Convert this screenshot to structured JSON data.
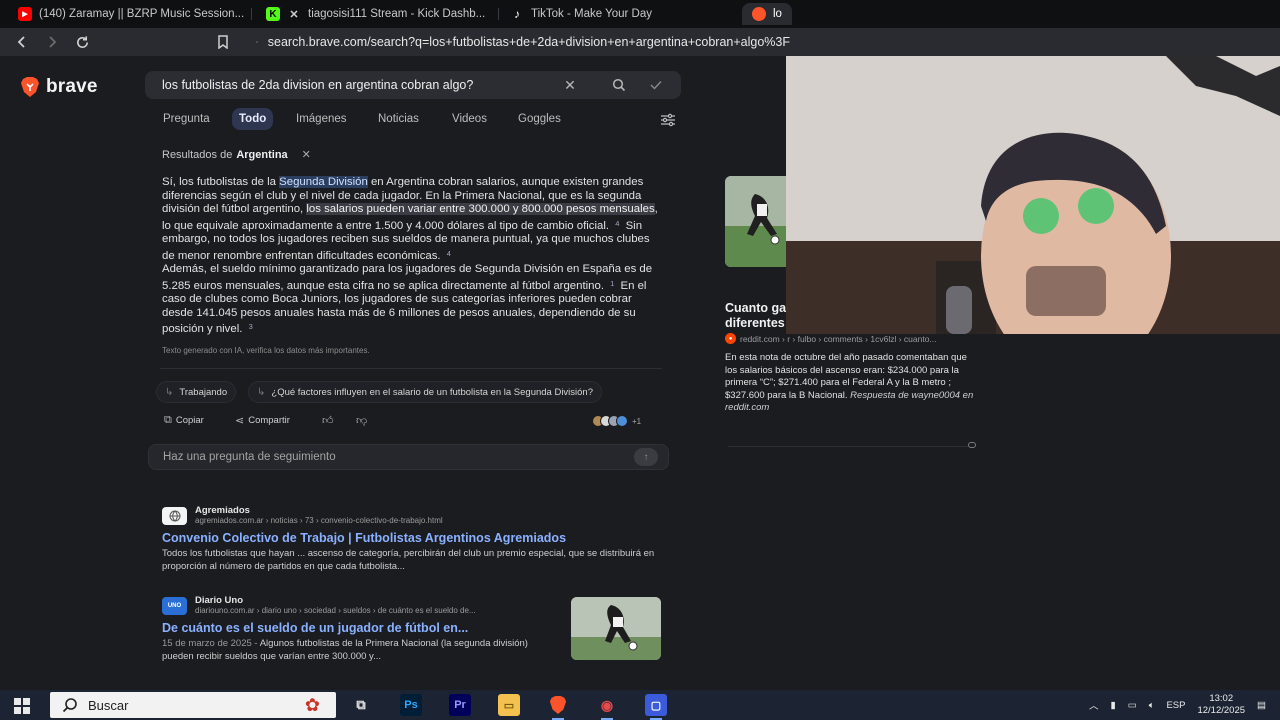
{
  "browser": {
    "tabs": [
      {
        "title": "(140) Zaramay || BZRP Music Session...",
        "icon": "youtube-icon",
        "color": "#ff0000"
      },
      {
        "title": "tiagosisi111 Stream - Kick Dashb...",
        "icon": "kick-icon",
        "color": "#53fc18"
      },
      {
        "title": "TikTok - Make Your Day",
        "icon": "tiktok-icon",
        "color": "#ffffff"
      },
      {
        "title": "lo",
        "icon": "brave-icon",
        "color": "#fb542b"
      }
    ],
    "url": "search.brave.com/search?q=los+futbolistas+de+2da+division+en+argentina+cobran+algo%3F"
  },
  "brave": {
    "logo": "brave",
    "query": "los futbolistas de 2da division en argentina cobran algo?",
    "nav_tabs": [
      "Pregunta",
      "Todo",
      "Imágenes",
      "Noticias",
      "Videos",
      "Goggles"
    ],
    "active_tab": "Todo",
    "region_label": "Resultados de",
    "region": "Argentina",
    "answer": {
      "p1a": "Sí, los futbolistas de la",
      "p1hl": "Segunda División",
      "p1b": "en Argentina cobran salarios, aunque existen grandes diferencias según el club y el nivel de cada jugador. En la Primera Nacional, que es la segunda división del fútbol argentino,",
      "p1hl2": "los salarios pueden variar entre 300.000 y 800.000 pesos mensuales",
      "p1c": ", lo que equivale aproximadamente a entre 1.500 y 4.000 dólares al tipo de cambio oficial.",
      "ref4a": "4",
      "p1d": "Sin embargo, no todos los jugadores reciben sus sueldos de manera puntual, ya que muchos clubes de menor renombre enfrentan dificultades económicas.",
      "ref4b": "4",
      "p2a": "Además, el sueldo mínimo garantizado para los jugadores de Segunda División en España es de 5.285 euros mensuales, aunque esta cifra no se aplica directamente al fútbol argentino.",
      "ref1": "1",
      "p2b": "En el caso de clubes como Boca Juniors, los jugadores de sus categorías inferiores pueden cobrar desde 141.045 pesos anuales hasta más de 6 millones de pesos anuales, dependiendo de su posición y nivel.",
      "ref3": "3"
    },
    "disclaimer": "Texto generado con IA, verifica los datos más importantes.",
    "chips": [
      "Trabajando",
      "¿Qué factores influyen en el salario de un futbolista en la Segunda División?"
    ],
    "actions": {
      "copy": "Copiar",
      "share": "Compartir"
    },
    "sources_count": "+1",
    "followup_placeholder": "Haz una pregunta de seguimiento",
    "results": [
      {
        "site": "Agremiados",
        "path": "agremiados.com.ar › noticias › 73 › convenio-colectivo-de-trabajo.html",
        "title": "Convenio Colectivo de Trabajo | Futbolistas Argentinos Agremiados",
        "snippet": "Todos los futbolistas que hayan ... ascenso de categoría, percibirán del club un premio especial, que se distribuirá en proporción al número de partidos en que cada futbolista..."
      },
      {
        "site": "Diario Uno",
        "badge": "UNO",
        "path": "diariouno.com.ar › diario uno › sociedad › sueldos › de cuánto es el sueldo de...",
        "title": "De cuánto es el sueldo de un jugador de fútbol en...",
        "date": "15 de marzo de 2025 -",
        "snippet": "Algunos futbolistas de la Primera Nacional (la segunda división) pueden recibir sueldos que varían entre 300.000 y..."
      }
    ],
    "side": {
      "title": "Cuanto ganan los jugadores de futbol en las diferentes categorias?",
      "source": "reddit.com › r › fulbo › comments › 1cv6lzl › cuanto...",
      "snippet": "En esta nota de octubre del año pasado comentaban que los salarios básicos del ascenso eran: $234.000 para la primera “C”; $271.400 para el Federal A y la B metro ; $327.600 para la B Nacional.",
      "attribution": "Respuesta de wayne0004 en reddit.com"
    }
  },
  "taskbar": {
    "search_placeholder": "Buscar",
    "lang": "ESP",
    "time": "13:02",
    "date": "12/12/2025"
  }
}
